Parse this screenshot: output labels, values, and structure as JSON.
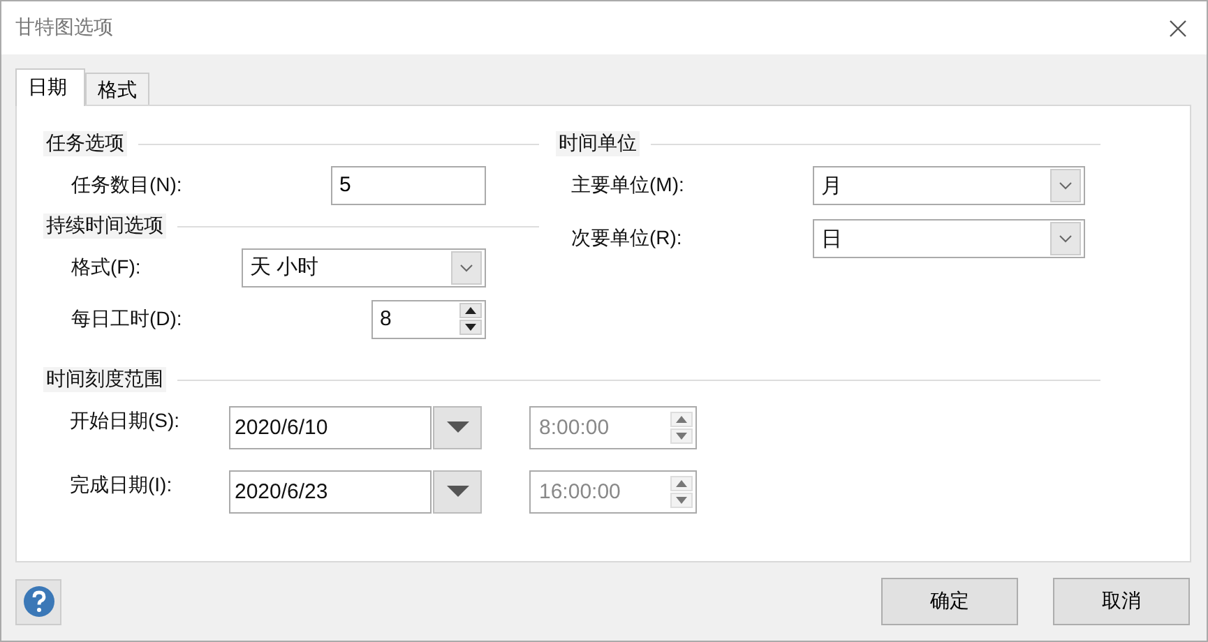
{
  "window": {
    "title": "甘特图选项"
  },
  "tabs": [
    {
      "label": "日期",
      "selected": true
    },
    {
      "label": "格式",
      "selected": false
    }
  ],
  "task_options": {
    "heading": "任务选项",
    "fields": [
      {
        "kind": "text",
        "label": "任务数目(N):",
        "value": "5"
      }
    ]
  },
  "duration_options": {
    "heading": "持续时间选项",
    "fields": [
      {
        "kind": "select",
        "label": "格式(F):",
        "value": "天 小时"
      },
      {
        "kind": "spin",
        "label": "每日工时(D):",
        "value": "8"
      }
    ]
  },
  "time_units": {
    "heading": "时间单位",
    "fields": [
      {
        "kind": "select",
        "label": "主要单位(M):",
        "value": "月"
      },
      {
        "kind": "select",
        "label": "次要单位(R):",
        "value": "日"
      }
    ]
  },
  "timescale_range": {
    "heading": "时间刻度范围",
    "rows": [
      {
        "label": "开始日期(S):",
        "date": "2020/6/10",
        "time": "8:00:00",
        "time_disabled": true
      },
      {
        "label": "完成日期(I):",
        "date": "2020/6/23",
        "time": "16:00:00",
        "time_disabled": true
      }
    ]
  },
  "buttons": [
    "确定",
    "取消"
  ]
}
